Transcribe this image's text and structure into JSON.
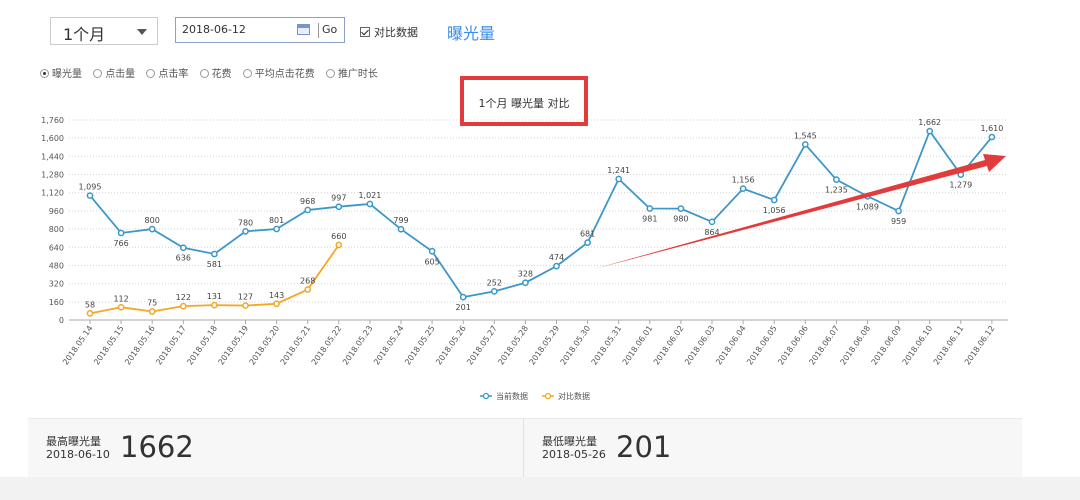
{
  "controls": {
    "range_value": "1个月",
    "date_value": "2018-06-12",
    "go_label": "Go",
    "compare_label": "对比数据",
    "metric_title": "曝光量"
  },
  "metrics": [
    {
      "label": "曝光量",
      "selected": true
    },
    {
      "label": "点击量",
      "selected": false
    },
    {
      "label": "点击率",
      "selected": false
    },
    {
      "label": "花费",
      "selected": false
    },
    {
      "label": "平均点击花费",
      "selected": false
    },
    {
      "label": "推广时长",
      "selected": false
    }
  ],
  "chart_data": {
    "type": "line",
    "title": "1个月  曝光量  对比",
    "categories": [
      "2018.05.14",
      "2018.05.15",
      "2018.05.16",
      "2018.05.17",
      "2018.05.18",
      "2018.05.19",
      "2018.05.20",
      "2018.05.21",
      "2018.05.22",
      "2018.05.23",
      "2018.05.24",
      "2018.05.25",
      "2018.05.26",
      "2018.05.27",
      "2018.05.28",
      "2018.05.29",
      "2018.05.30",
      "2018.05.31",
      "2018.06.01",
      "2018.06.02",
      "2018.06.03",
      "2018.06.04",
      "2018.06.05",
      "2018.06.06",
      "2018.06.07",
      "2018.06.08",
      "2018.06.09",
      "2018.06.10",
      "2018.06.11",
      "2018.06.12"
    ],
    "series": [
      {
        "name": "当前数据",
        "color": "#3c97c9",
        "values": [
          1095,
          766,
          800,
          636,
          581,
          780,
          801,
          968,
          997,
          1021,
          799,
          605,
          201,
          252,
          328,
          474,
          681,
          1241,
          981,
          980,
          864,
          1156,
          1056,
          1545,
          1235,
          1089,
          959,
          1662,
          1279,
          1610
        ]
      },
      {
        "name": "对比数据",
        "color": "#f5a623",
        "values": [
          58,
          112,
          75,
          122,
          131,
          127,
          143,
          268,
          660
        ]
      }
    ],
    "ylim": [
      0,
      1760
    ],
    "yticks": [
      0,
      160,
      320,
      480,
      640,
      800,
      960,
      1120,
      1280,
      1440,
      1600,
      1760
    ],
    "grid": true,
    "legend": "bottom-center",
    "annotation_arrow_color": "#e23b3b"
  },
  "stats": {
    "max": {
      "label": "最高曝光量",
      "date": "2018-06-10",
      "value": "1662"
    },
    "min": {
      "label": "最低曝光量",
      "date": "2018-05-26",
      "value": "201"
    }
  }
}
